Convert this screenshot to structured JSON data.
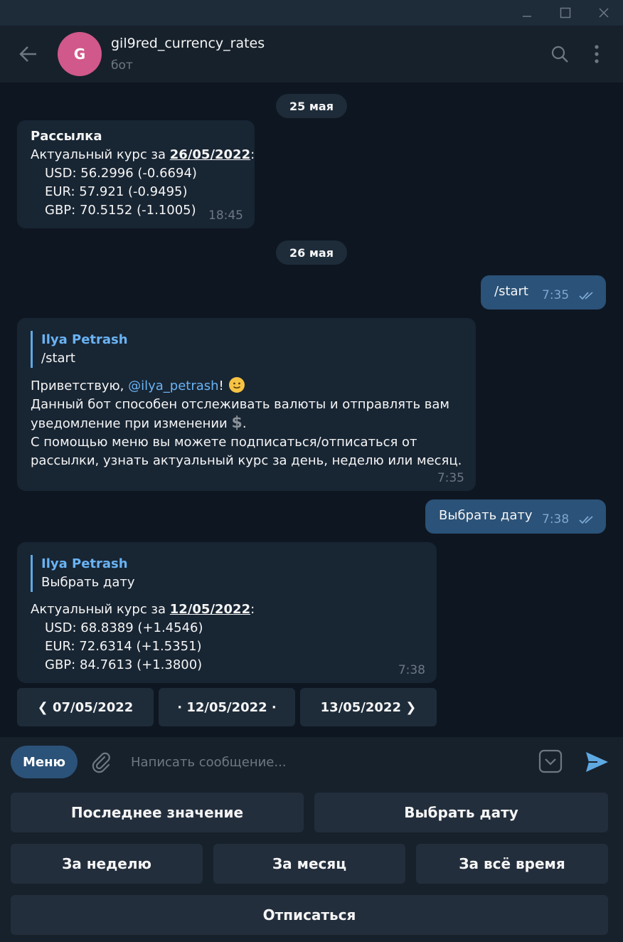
{
  "colors": {
    "accent": "#2b5278",
    "link": "#6ab3f3",
    "avatar": "#d0588a",
    "bg": "#0e1621"
  },
  "window": {
    "minimize_icon": "minimize-icon",
    "maximize_icon": "maximize-icon",
    "close_icon": "close-icon"
  },
  "header": {
    "avatar_letter": "G",
    "name": "gil9red_currency_rates",
    "subtitle": "бот"
  },
  "dates": [
    "25 мая",
    "26 мая"
  ],
  "messages": {
    "m1": {
      "title": "Рассылка",
      "line_prefix": "Актуальный курс за ",
      "date": "26/05/2022",
      "colon": ":",
      "usd": "USD: 56.2996 (-0.6694)",
      "eur": "EUR: 57.921 (-0.9495)",
      "gbp": "GBP: 70.5152 (-1.1005)",
      "time": "18:45"
    },
    "m2": {
      "text": "/start",
      "time": "7:35"
    },
    "m3": {
      "quote_name": "Ilya Petrash",
      "quote_text": "/start",
      "greet_prefix": "Приветствую, ",
      "mention": "@ilya_petrash",
      "greet_suffix": "!",
      "line2": "Данный бот способен отслеживать валюты и отправлять вам",
      "line3": "уведомление при изменении",
      "line3_end": ".",
      "line4": "С помощью меню вы можете подписаться/отписаться от",
      "line5": "рассылки, узнать актуальный курс за день, неделю или месяц.",
      "time": "7:35"
    },
    "m4": {
      "text": "Выбрать дату",
      "time": "7:38"
    },
    "m5": {
      "quote_name": "Ilya Petrash",
      "quote_text": "Выбрать дату",
      "line_prefix": "Актуальный курс за ",
      "date": "12/05/2022",
      "colon": ":",
      "usd": "USD: 68.8389 (+1.4546)",
      "eur": "EUR: 72.6314 (+1.5351)",
      "gbp": "GBP: 84.7613 (+1.3800)",
      "time": "7:38"
    }
  },
  "inline_buttons": {
    "prev": "❮ 07/05/2022",
    "current": "· 12/05/2022 ·",
    "next": "13/05/2022 ❯"
  },
  "composer": {
    "menu_label": "Меню",
    "placeholder": "Написать сообщение..."
  },
  "reply_keyboard": {
    "last_value": "Последнее значение",
    "choose_date": "Выбрать дату",
    "week": "За неделю",
    "month": "За месяц",
    "all_time": "За всё время",
    "unsubscribe": "Отписаться"
  }
}
